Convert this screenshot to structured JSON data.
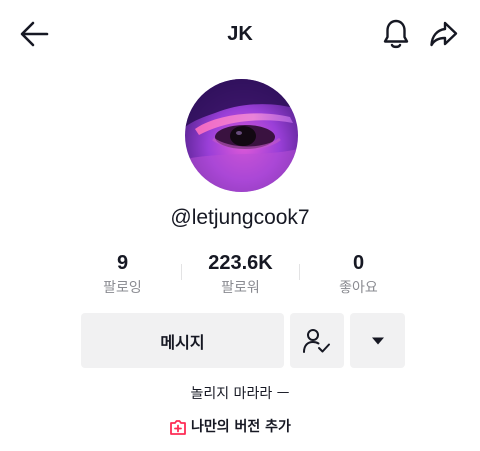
{
  "header": {
    "title": "JK",
    "back_icon": "arrow-left-icon",
    "bell_icon": "bell-icon",
    "share_icon": "share-arrow-icon"
  },
  "profile": {
    "username": "@letjungcook7",
    "avatar": "avatar-purple-eye-closeup"
  },
  "stats": [
    {
      "value": "9",
      "label": "팔로잉"
    },
    {
      "value": "223.6K",
      "label": "팔로워"
    },
    {
      "value": "0",
      "label": "좋아요"
    }
  ],
  "actions": {
    "message_label": "메시지",
    "follow_icon": "user-check-icon",
    "more_icon": "caret-down-icon"
  },
  "bio": "놀리지 마라라 ㅡ",
  "add_version": {
    "label": "나만의 버전 추가",
    "icon": "plus-square-icon",
    "icon_color": "#fe2c55"
  }
}
